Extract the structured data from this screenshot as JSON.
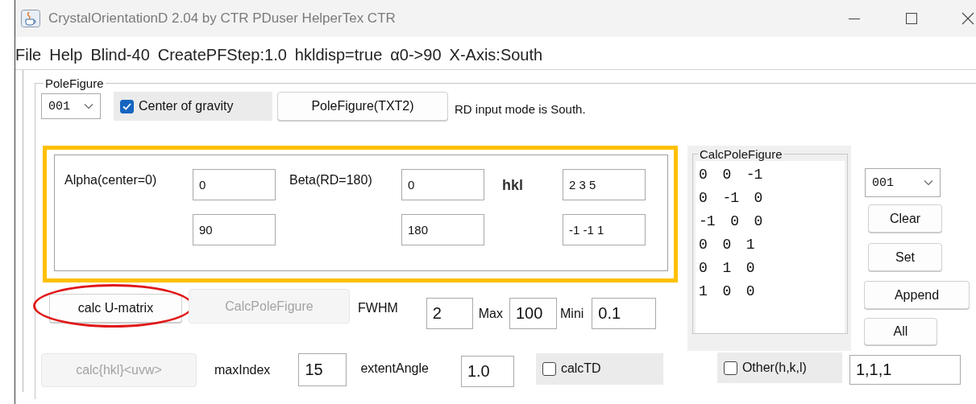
{
  "window": {
    "title": "CrystalOrientationD 2.04 by CTR PDuser HelperTex CTR"
  },
  "menu": [
    "File",
    "Help",
    "Blind-40",
    "CreatePFStep:1.0",
    "hkldisp=true",
    "α0->90",
    "X-Axis:South"
  ],
  "pole_figure": {
    "legend": "PoleFigure",
    "combo": {
      "value": "001"
    },
    "center_of_gravity": {
      "label": "Center of gravity",
      "checked": true
    },
    "button": {
      "label": "PoleFigure(TXT2)",
      "disabled": false
    },
    "status": "RD input mode is South."
  },
  "orientation": {
    "highlighted": true,
    "alpha_label": "Alpha(center=0)",
    "alpha_values": [
      "0",
      "90"
    ],
    "beta_label": "Beta(RD=180)",
    "beta_values": [
      "0",
      "180"
    ],
    "hkl_label": "hkl",
    "hkl_values": [
      "2 3 5",
      "-1 -1 1"
    ]
  },
  "calc_row": {
    "buttons": [
      {
        "label": "calc U-matrix",
        "disabled": false,
        "highlighted": true
      },
      {
        "label": "CalcPoleFigure",
        "disabled": true,
        "highlighted": false
      }
    ],
    "fields": [
      {
        "label": "FWHM",
        "value": "2"
      },
      {
        "label": "Max",
        "value": "100"
      },
      {
        "label": "Mini",
        "value": "0.1"
      }
    ]
  },
  "calc_pole_figure": {
    "legend": "CalcPoleFigure",
    "items": [
      "0  0  -1",
      "0  -1  0",
      "-1  0  0",
      "0  0  1",
      "0  1  0",
      "1  0  0"
    ]
  },
  "side": {
    "combo": {
      "value": "001"
    },
    "buttons": [
      "Clear",
      "Set",
      "Append",
      "All"
    ]
  },
  "bottom_row": {
    "button": {
      "label": "calc{hkl}<uvw>",
      "disabled": true
    },
    "max_index": {
      "label": "maxIndex",
      "value": "15"
    },
    "extent_angle": {
      "label": "extentAngle",
      "value": "1.0"
    },
    "calc_td": {
      "label": "calcTD",
      "checked": false
    },
    "other": {
      "label": "Other(h,k,l)",
      "checked": false,
      "value": "1,1,1"
    }
  }
}
